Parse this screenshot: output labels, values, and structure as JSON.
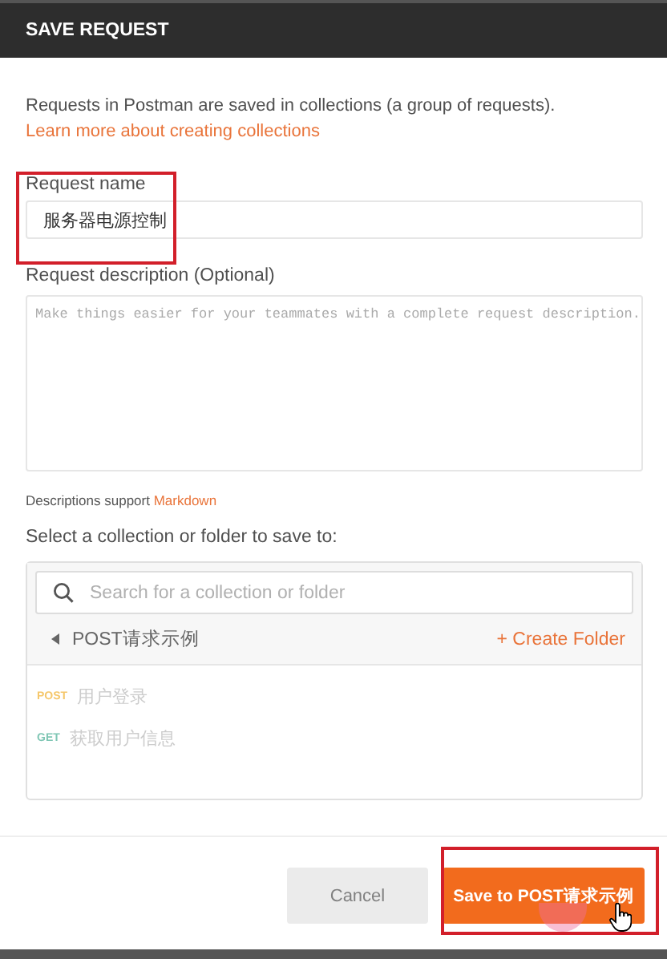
{
  "dialog": {
    "title": "SAVE REQUEST"
  },
  "intro": {
    "text": "Requests in Postman are saved in collections (a group of requests).",
    "link": "Learn more about creating collections"
  },
  "request_name": {
    "label": "Request name",
    "value": "服务器电源控制"
  },
  "request_description": {
    "label": "Request description (Optional)",
    "placeholder": "Make things easier for your teammates with a complete request description."
  },
  "markdown_note": {
    "text": "Descriptions support",
    "link": "Markdown"
  },
  "collection_picker": {
    "label": "Select a collection or folder to save to:",
    "search_placeholder": "Search for a collection or folder",
    "folder": "POST请求示例",
    "create_folder": "+ Create Folder",
    "requests": [
      {
        "method": "POST",
        "name": "用户登录",
        "color": "#f5c76b"
      },
      {
        "method": "GET",
        "name": "获取用户信息",
        "color": "#7fc6b4"
      }
    ]
  },
  "buttons": {
    "cancel": "Cancel",
    "save": "Save to POST请求示例"
  }
}
